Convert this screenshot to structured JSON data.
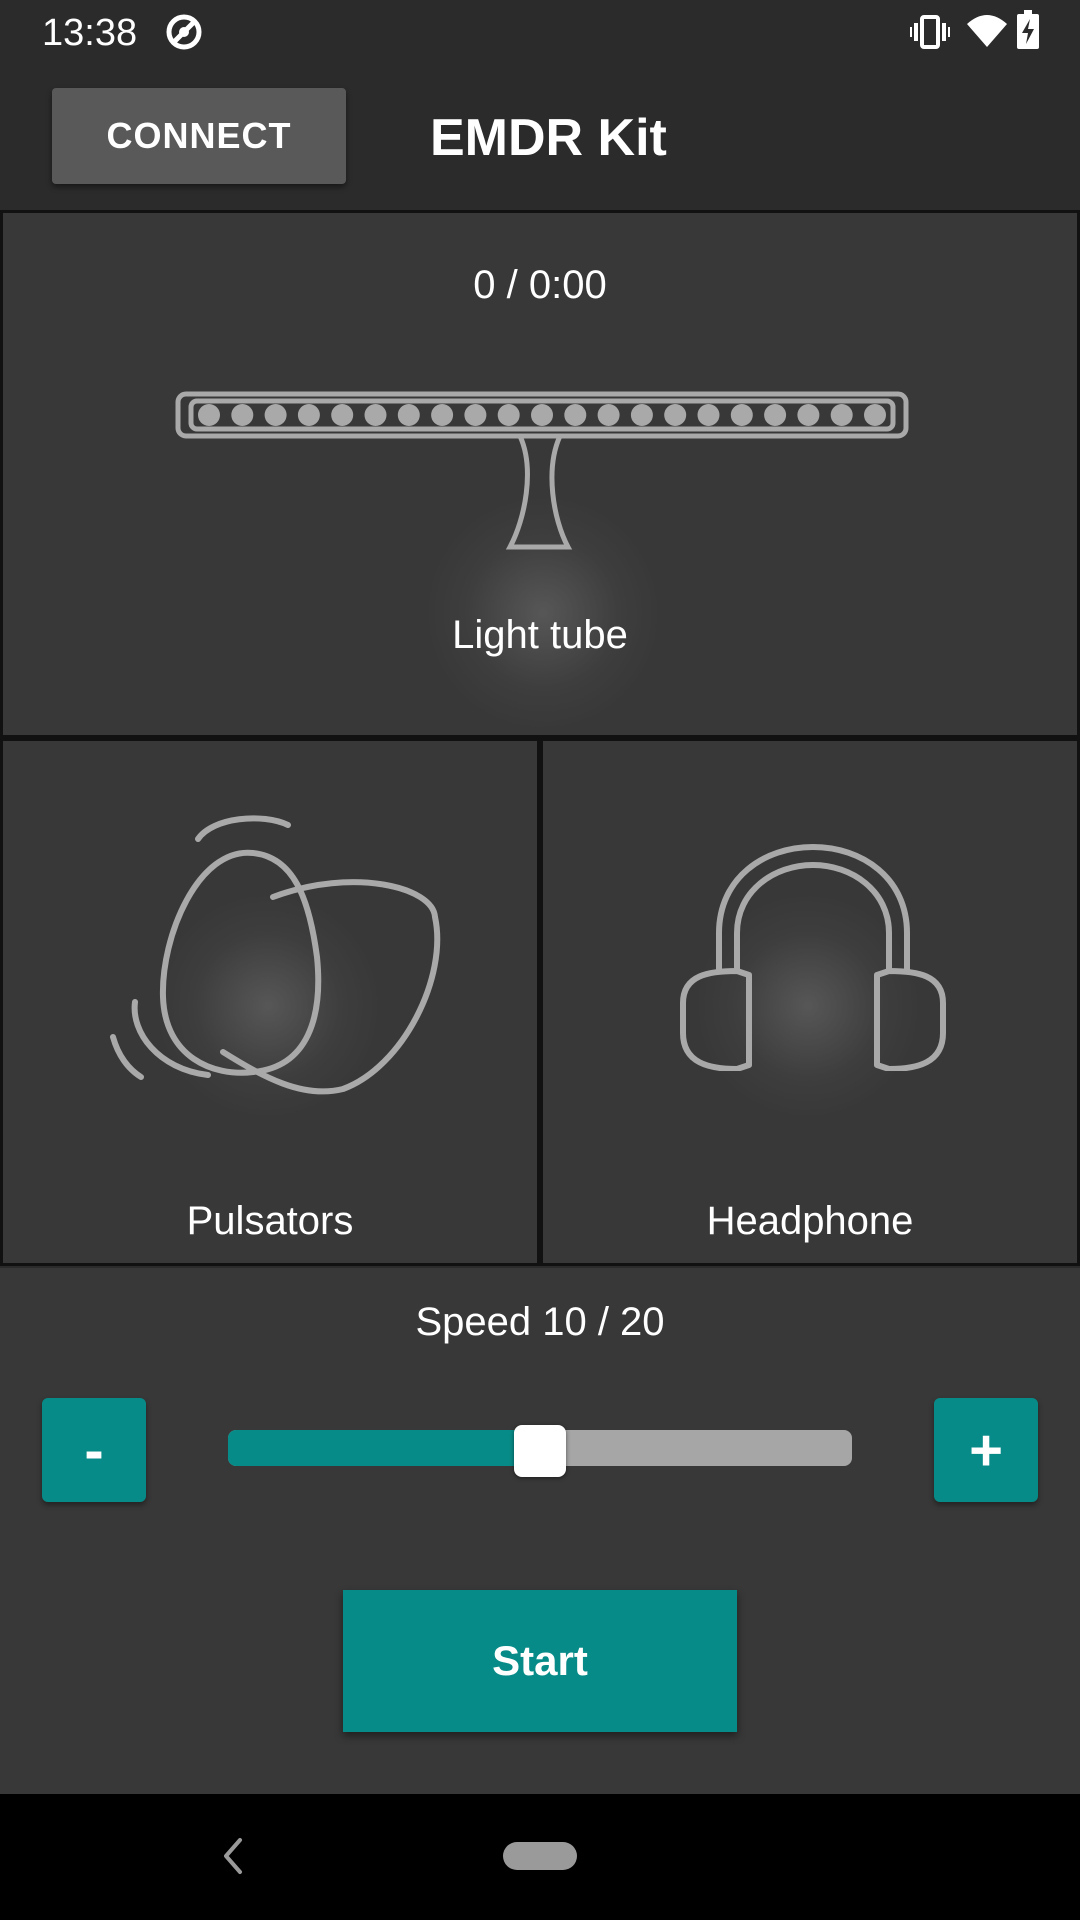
{
  "status_bar": {
    "time": "13:38",
    "icons": [
      "data-saver-icon",
      "vibrate-icon",
      "wifi-icon",
      "battery-charging-icon"
    ]
  },
  "app_bar": {
    "connect_label": "CONNECT",
    "title": "EMDR Kit"
  },
  "light_tube": {
    "session_readout": "0 / 0:00",
    "label": "Light tube",
    "icon": "light-tube-icon"
  },
  "pulsators": {
    "label": "Pulsators",
    "icon": "pulsators-icon"
  },
  "headphone": {
    "label": "Headphone",
    "icon": "headphone-icon"
  },
  "speed": {
    "label": "Speed 10 / 20",
    "value": 10,
    "max": 20,
    "decrease_label": "-",
    "increase_label": "+"
  },
  "start_label": "Start",
  "colors": {
    "accent": "#078b88",
    "background": "#2b2b2b",
    "panel": "#383838",
    "icon_stroke": "#a9a9a9"
  },
  "nav_bar": {
    "icons": [
      "back-icon",
      "home-pill-icon"
    ]
  }
}
